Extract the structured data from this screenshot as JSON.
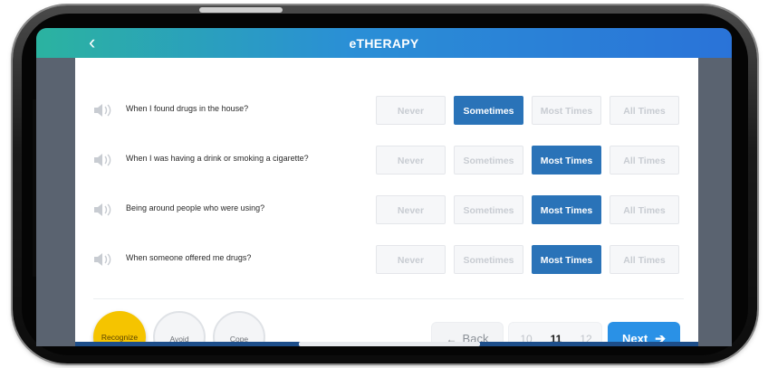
{
  "header": {
    "back_glyph": "‹",
    "title": "eTHERAPY"
  },
  "options": [
    "Never",
    "Sometimes",
    "Most Times",
    "All Times"
  ],
  "questions": [
    {
      "text": "When I found drugs in the house?",
      "selected": "Sometimes"
    },
    {
      "text": "When I was having a drink or smoking a cigarette?",
      "selected": "Most Times"
    },
    {
      "text": "Being around people who were using?",
      "selected": "Most Times"
    },
    {
      "text": "When someone offered me drugs?",
      "selected": "Most Times"
    }
  ],
  "steps": [
    {
      "label": "Recognize",
      "active": true
    },
    {
      "label": "Avoid",
      "active": false
    },
    {
      "label": "Cope",
      "active": false
    }
  ],
  "pagination": {
    "back_label": "Back",
    "back_icon": "arrow-left-icon",
    "pages": [
      "10",
      "11",
      "12"
    ],
    "current": "11",
    "next_label": "Next",
    "next_icon": "arrow-right-icon"
  },
  "colors": {
    "header_start": "#2bb3a0",
    "header_end": "#2a73d8",
    "selected": "#2a73b8",
    "recognize": "#f5c400",
    "next_button": "#2a91e6"
  }
}
